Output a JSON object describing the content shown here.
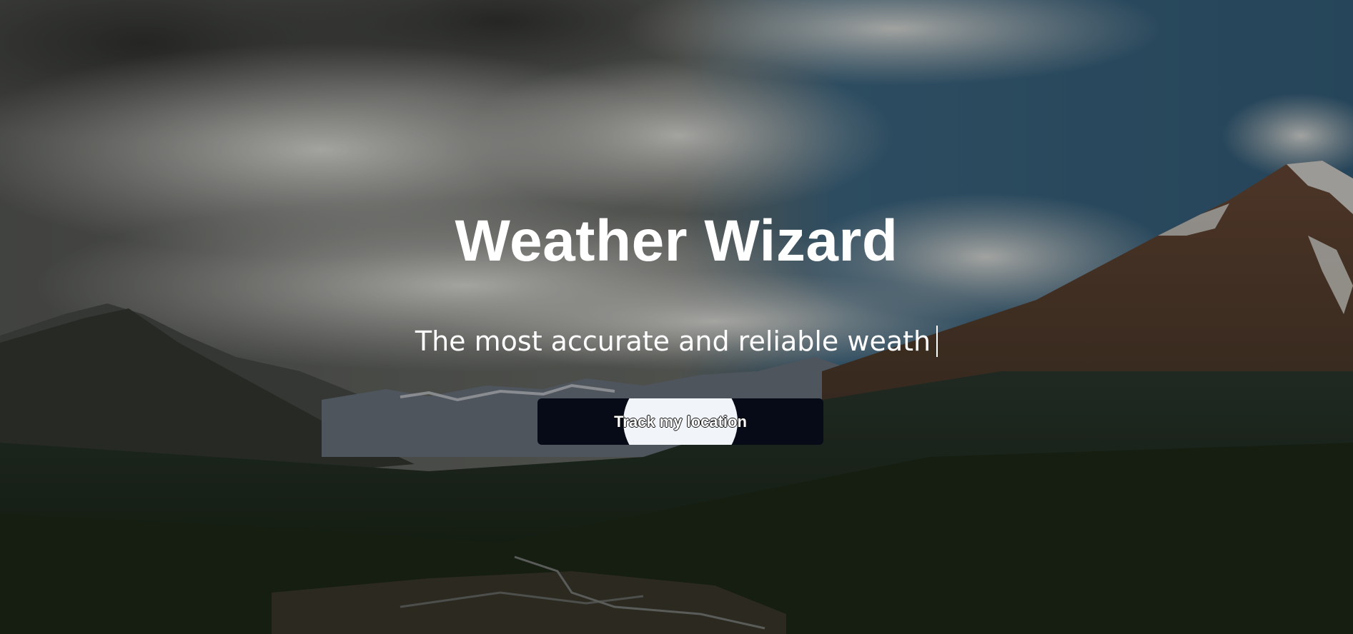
{
  "hero": {
    "title": "Weather Wizard",
    "subtitle": "The most accurate and reliable weath",
    "cta_label": "Track my location",
    "background_description": "mountain-valley-photo",
    "colors": {
      "title": "#ffffff",
      "button_bg": "#070b18",
      "button_ripple": "#f1f5f9",
      "button_text": "#ffffff"
    }
  }
}
